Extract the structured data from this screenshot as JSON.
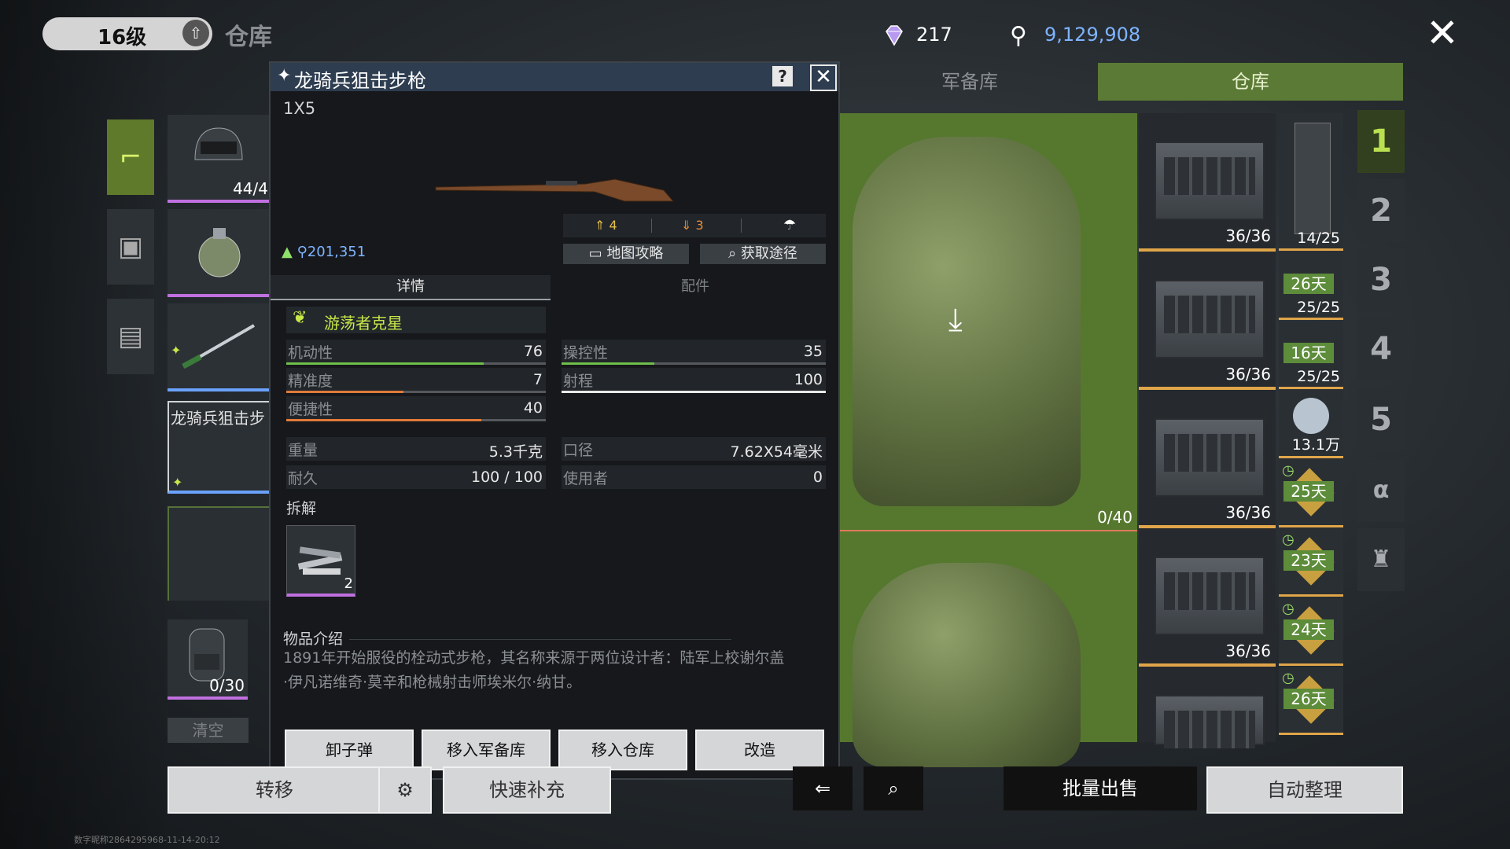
{
  "header": {
    "level": "16级",
    "title": "仓库",
    "diamonds": "217",
    "coins": "9,129,908",
    "colors": {
      "accent_green": "#5b7a35",
      "coin_blue": "#7fb4ff"
    }
  },
  "tabs": [
    {
      "label": "军备库"
    },
    {
      "label": "仓库"
    }
  ],
  "left_slots": {
    "helmet_count": "44/4",
    "sniper_name": "龙骑兵狙击步",
    "backpack_count": "0/30",
    "clear_label": "清空"
  },
  "dialog": {
    "title": "龙骑兵狙击步枪",
    "help": "?",
    "size": "1X5",
    "upgrade": "4",
    "downgrade": "3",
    "price": "201,351",
    "map_guide": "地图攻略",
    "get_route": "获取途径",
    "tab_details": "详情",
    "tab_parts": "配件",
    "perk": "游荡者克星",
    "stats_left": [
      {
        "label": "机动性",
        "value": "76",
        "fill": 0.76,
        "color": "#6fbf4a"
      },
      {
        "label": "精准度",
        "value": "7",
        "fill": 0.45,
        "color": "#e07a3a"
      },
      {
        "label": "便捷性",
        "value": "40",
        "fill": 0.75,
        "color": "#e07a3a"
      }
    ],
    "stats_right": [
      {
        "label": "操控性",
        "value": "35",
        "fill": 0.35,
        "color": "#6fbf4a"
      },
      {
        "label": "射程",
        "value": "100",
        "fill": 1.0,
        "color": "#e8e8e8"
      }
    ],
    "info_left": [
      {
        "label": "重量",
        "value": "5.3千克"
      },
      {
        "label": "耐久",
        "value": "100 / 100"
      }
    ],
    "info_right": [
      {
        "label": "口径",
        "value": "7.62X54毫米"
      },
      {
        "label": "使用者",
        "value": "0"
      }
    ],
    "dismantle_label": "拆解",
    "dismantle_count": "2",
    "desc_label": "物品介绍",
    "description": "1891年开始服役的栓动式步枪，其名称来源于两位设计者：陆军上校谢尔盖·伊凡诺维奇·莫辛和枪械射击师埃米尔·纳甘。",
    "actions": [
      "卸子弹",
      "移入军备库",
      "移入仓库",
      "改造"
    ]
  },
  "storage": {
    "bag_count": "0/40",
    "crate_count": "36/36",
    "minis": [
      {
        "value": "14/25",
        "day": ""
      },
      {
        "value": "25/25",
        "day": "26天"
      },
      {
        "value": "25/25",
        "day": "16天"
      },
      {
        "value": "13.1万",
        "day": ""
      },
      {
        "value": "",
        "day": "25天"
      },
      {
        "value": "",
        "day": "23天"
      },
      {
        "value": "",
        "day": "24天"
      },
      {
        "value": "",
        "day": "26天"
      }
    ]
  },
  "pages": [
    "1",
    "2",
    "3",
    "4",
    "5"
  ],
  "bottom": {
    "transfer": "转移",
    "quick_refill": "快速补充",
    "bulk_sell": "批量出售",
    "auto_sort": "自动整理"
  },
  "footer_note": "数字昵称2864295968-11-14-20:12"
}
